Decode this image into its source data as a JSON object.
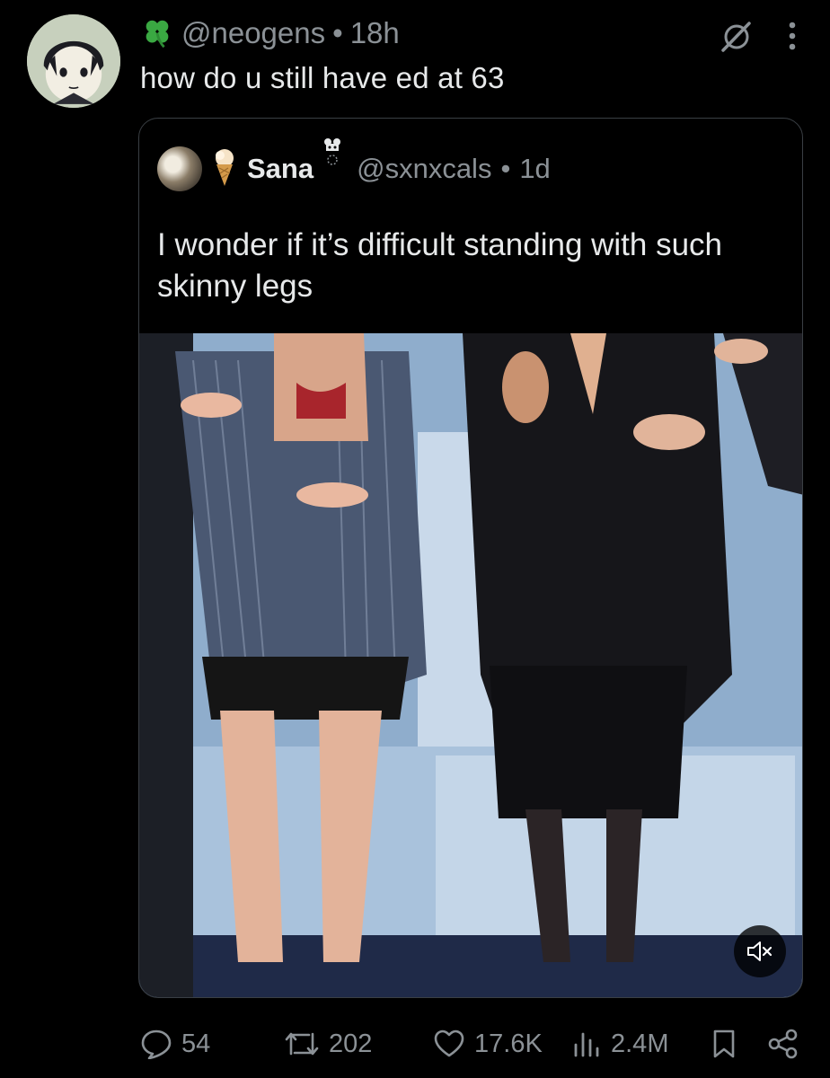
{
  "post": {
    "handle": "@neogens",
    "separator": "•",
    "time": "18h",
    "text": "how do u still have ed at 63",
    "handle_emoji": "clover-icon"
  },
  "quoted": {
    "name": "Sana",
    "handle": "@sxnxcals",
    "separator": "•",
    "time": "1d",
    "text": "I wonder if it’s difficult standing with such skinny legs",
    "name_prefix_emoji": "ice-cream-icon",
    "name_suffix_emoji": "bear-icon"
  },
  "stats": {
    "replies": "54",
    "reposts": "202",
    "likes": "17.6K",
    "views": "2.4M"
  },
  "colors": {
    "background": "#000000",
    "text_primary": "#e7e9ea",
    "text_secondary": "#8b9196",
    "card_border": "#3a3f44"
  }
}
